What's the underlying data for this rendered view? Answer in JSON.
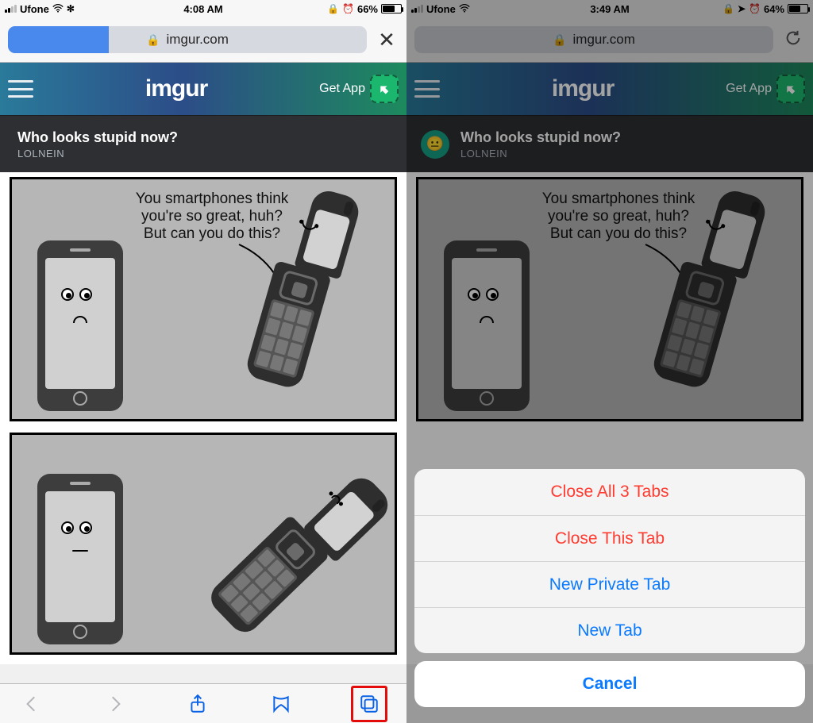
{
  "left": {
    "status": {
      "carrier": "Ufone",
      "time": "4:08 AM",
      "battery": "66%"
    },
    "addr": {
      "domain": "imgur.com",
      "progress_pct": 28
    },
    "imgur": {
      "logo": "imgur",
      "get_app": "Get App"
    },
    "post": {
      "title": "Who looks stupid now?",
      "author": "LOLNEIN"
    },
    "comic_speech": "You smartphones think\nyou're so great, huh?\nBut can you do this?"
  },
  "right": {
    "status": {
      "carrier": "Ufone",
      "time": "3:49 AM",
      "battery": "64%"
    },
    "addr": {
      "domain": "imgur.com"
    },
    "imgur": {
      "logo": "imgur",
      "get_app": "Get App"
    },
    "post": {
      "title": "Who looks stupid now?",
      "author": "LOLNEIN"
    },
    "comic_speech": "You smartphones think\nyou're so great, huh?\nBut can you do this?",
    "sheet": {
      "close_all": "Close All 3 Tabs",
      "close_this": "Close This Tab",
      "new_private": "New Private Tab",
      "new_tab": "New Tab",
      "cancel": "Cancel"
    }
  }
}
